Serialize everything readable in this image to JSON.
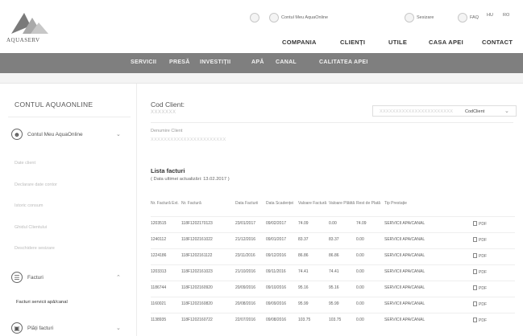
{
  "brand": {
    "logo_text": "AQUASERV"
  },
  "top_utils": {
    "account_label": "Contul Meu AquaOnline",
    "ticket_label": "Sesizare",
    "faq_label": "FAQ",
    "lang_hu": "HU",
    "lang_ro": "RO"
  },
  "main_nav": [
    "COMPANIA",
    "CLIENȚI",
    "UTILE",
    "CASA APEI",
    "CONTACT"
  ],
  "sub_nav": [
    "SERVICII",
    "PRESĂ",
    "INVESTIȚII",
    "APĂ",
    "CANAL",
    "CALITATEA APEI"
  ],
  "sidebar": {
    "title": "CONTUL AQUAONLINE",
    "group_account": "Contul Meu AquaOnline",
    "links": [
      "Date client",
      "Declarare date contor",
      "Istoric consum",
      "Ghidul Clientului",
      "Deschidere sesizare"
    ],
    "group_invoices": "Facturi",
    "active_item": "Facturi servicii apă/canal",
    "group_payments": "Plăți facturi"
  },
  "content": {
    "cod_label": "Cod Client:",
    "cod_value": "XXXXXXX",
    "select_blurred": "XXXXXXXXXXXXXXXXXXXXXXX",
    "select_label": "CodClient",
    "den_label": "Denumire Client",
    "den_value": "XXXXXXXXXXXXXXXXXXXXXXX",
    "list_title": "Lista facturi",
    "list_update": "( Data ultimei actualizări: 13.02.2017 )"
  },
  "table": {
    "headers": [
      "Nr. Factură Ext.",
      "Nr. Factură",
      "Data Facturii",
      "Data Scadenței",
      "Valoare Factură",
      "Valoare Plătită",
      "Rest de Plată",
      "Tip Prestație",
      ""
    ],
    "rows": [
      [
        "1203515",
        "118F1202170123",
        "23/01/2017",
        "09/02/2017",
        "74.09",
        "0.00",
        "74.09",
        "SERVICII APA/CANAL",
        "PDF"
      ],
      [
        "1240112",
        "118F1202161022",
        "21/12/2016",
        "09/01/2017",
        "83.37",
        "83.37",
        "0.00",
        "SERVICII APA/CANAL",
        "PDF"
      ],
      [
        "1224186",
        "118F1202161122",
        "23/11/2016",
        "09/12/2016",
        "86.86",
        "86.86",
        "0.00",
        "SERVICII APA/CANAL",
        "PDF"
      ],
      [
        "1203313",
        "118F1202161023",
        "21/10/2016",
        "09/11/2016",
        "74.41",
        "74.41",
        "0.00",
        "SERVICII APA/CANAL",
        "PDF"
      ],
      [
        "1186744",
        "118F1202160920",
        "20/09/2016",
        "09/10/2016",
        "95.16",
        "95.16",
        "0.00",
        "SERVICII APA/CANAL",
        "PDF"
      ],
      [
        "1160021",
        "118F1202160820",
        "20/08/2016",
        "09/09/2016",
        "95.99",
        "95.99",
        "0.00",
        "SERVICII APA/CANAL",
        "PDF"
      ],
      [
        "1138935",
        "118F1202160722",
        "22/07/2016",
        "09/08/2016",
        "103.75",
        "103.75",
        "0.00",
        "SERVICII APA/CANAL",
        "PDF"
      ]
    ]
  },
  "colors": {
    "subnav_bg": "#7f7f7f",
    "subnav_text": "#f2f2f2",
    "border": "#ececec",
    "text_main": "#444444"
  },
  "icons": {
    "account": "user-icon",
    "invoices": "invoice-icon",
    "payments": "wallet-icon",
    "pdf": "pdf-icon"
  }
}
